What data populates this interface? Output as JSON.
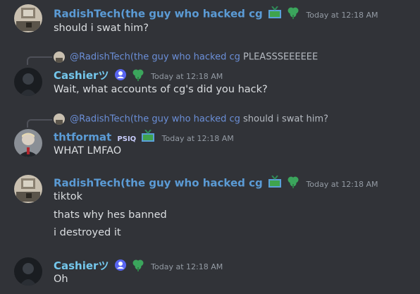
{
  "colors": {
    "background": "#313338",
    "radish_name": "#5b9bd5",
    "cashier_name": "#74c7ec",
    "thtformat_name": "#5b9bd5"
  },
  "messages": [
    {
      "author": "RadishTech(the guy who hacked cg",
      "timestamp": "Today at 12:18 AM",
      "lines": [
        "should i swat him?"
      ]
    },
    {
      "reply_to": "@RadishTech(the guy who hacked cg",
      "reply_text": "PLEASSSEEEEEE",
      "author": "Cashierツ",
      "timestamp": "Today at 12:18 AM",
      "lines": [
        "Wait, what accounts of cg's did you hack?"
      ]
    },
    {
      "reply_to": "@RadishTech(the guy who hacked cg",
      "reply_text": "should i swat him?",
      "author": "thtformat",
      "tag": "PSIQ",
      "timestamp": "Today at 12:18 AM",
      "lines": [
        "WHAT LMFAO"
      ]
    },
    {
      "author": "RadishTech(the guy who hacked cg",
      "timestamp": "Today at 12:18 AM",
      "lines": [
        "tiktok",
        "thats why hes banned",
        "i destroyed it"
      ]
    },
    {
      "author": "Cashierツ",
      "timestamp": "Today at 12:18 AM",
      "lines": [
        "Oh"
      ]
    }
  ]
}
